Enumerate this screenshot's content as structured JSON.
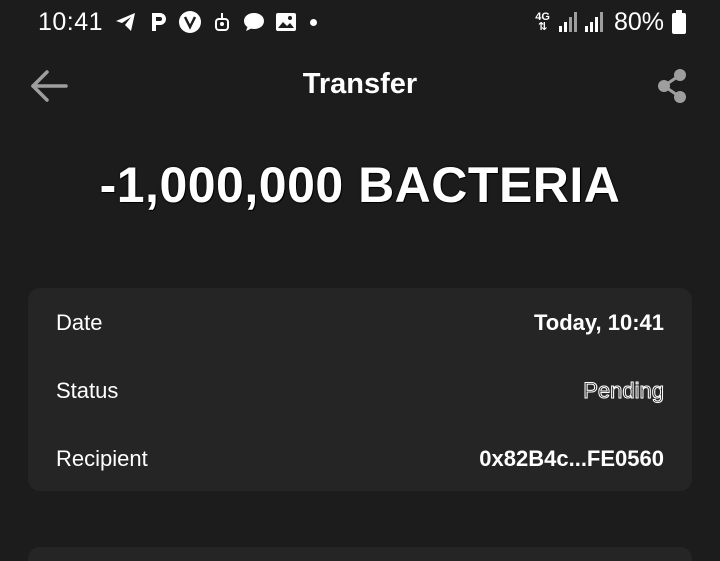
{
  "status_bar": {
    "time": "10:41",
    "notification_icons": [
      "telegram-icon",
      "p-app-icon",
      "v-badge-icon",
      "robot-icon",
      "chat-bubble-icon",
      "image-icon"
    ],
    "network_label_top": "4G",
    "network_label_bottom": "⇅",
    "battery_percent": "80%"
  },
  "header": {
    "title": "Transfer",
    "back_icon": "arrow-left-icon",
    "share_icon": "share-icon"
  },
  "amount": "-1,000,000 BACTERIA",
  "details": {
    "rows": [
      {
        "label": "Date",
        "value": "Today, 10:41"
      },
      {
        "label": "Status",
        "value": "Pending"
      },
      {
        "label": "Recipient",
        "value": "0x82B4c...FE0560"
      }
    ]
  },
  "colors": {
    "background": "#1c1c1c",
    "card": "#252525",
    "text": "#ffffff",
    "icon_muted": "#9e9e9e"
  }
}
